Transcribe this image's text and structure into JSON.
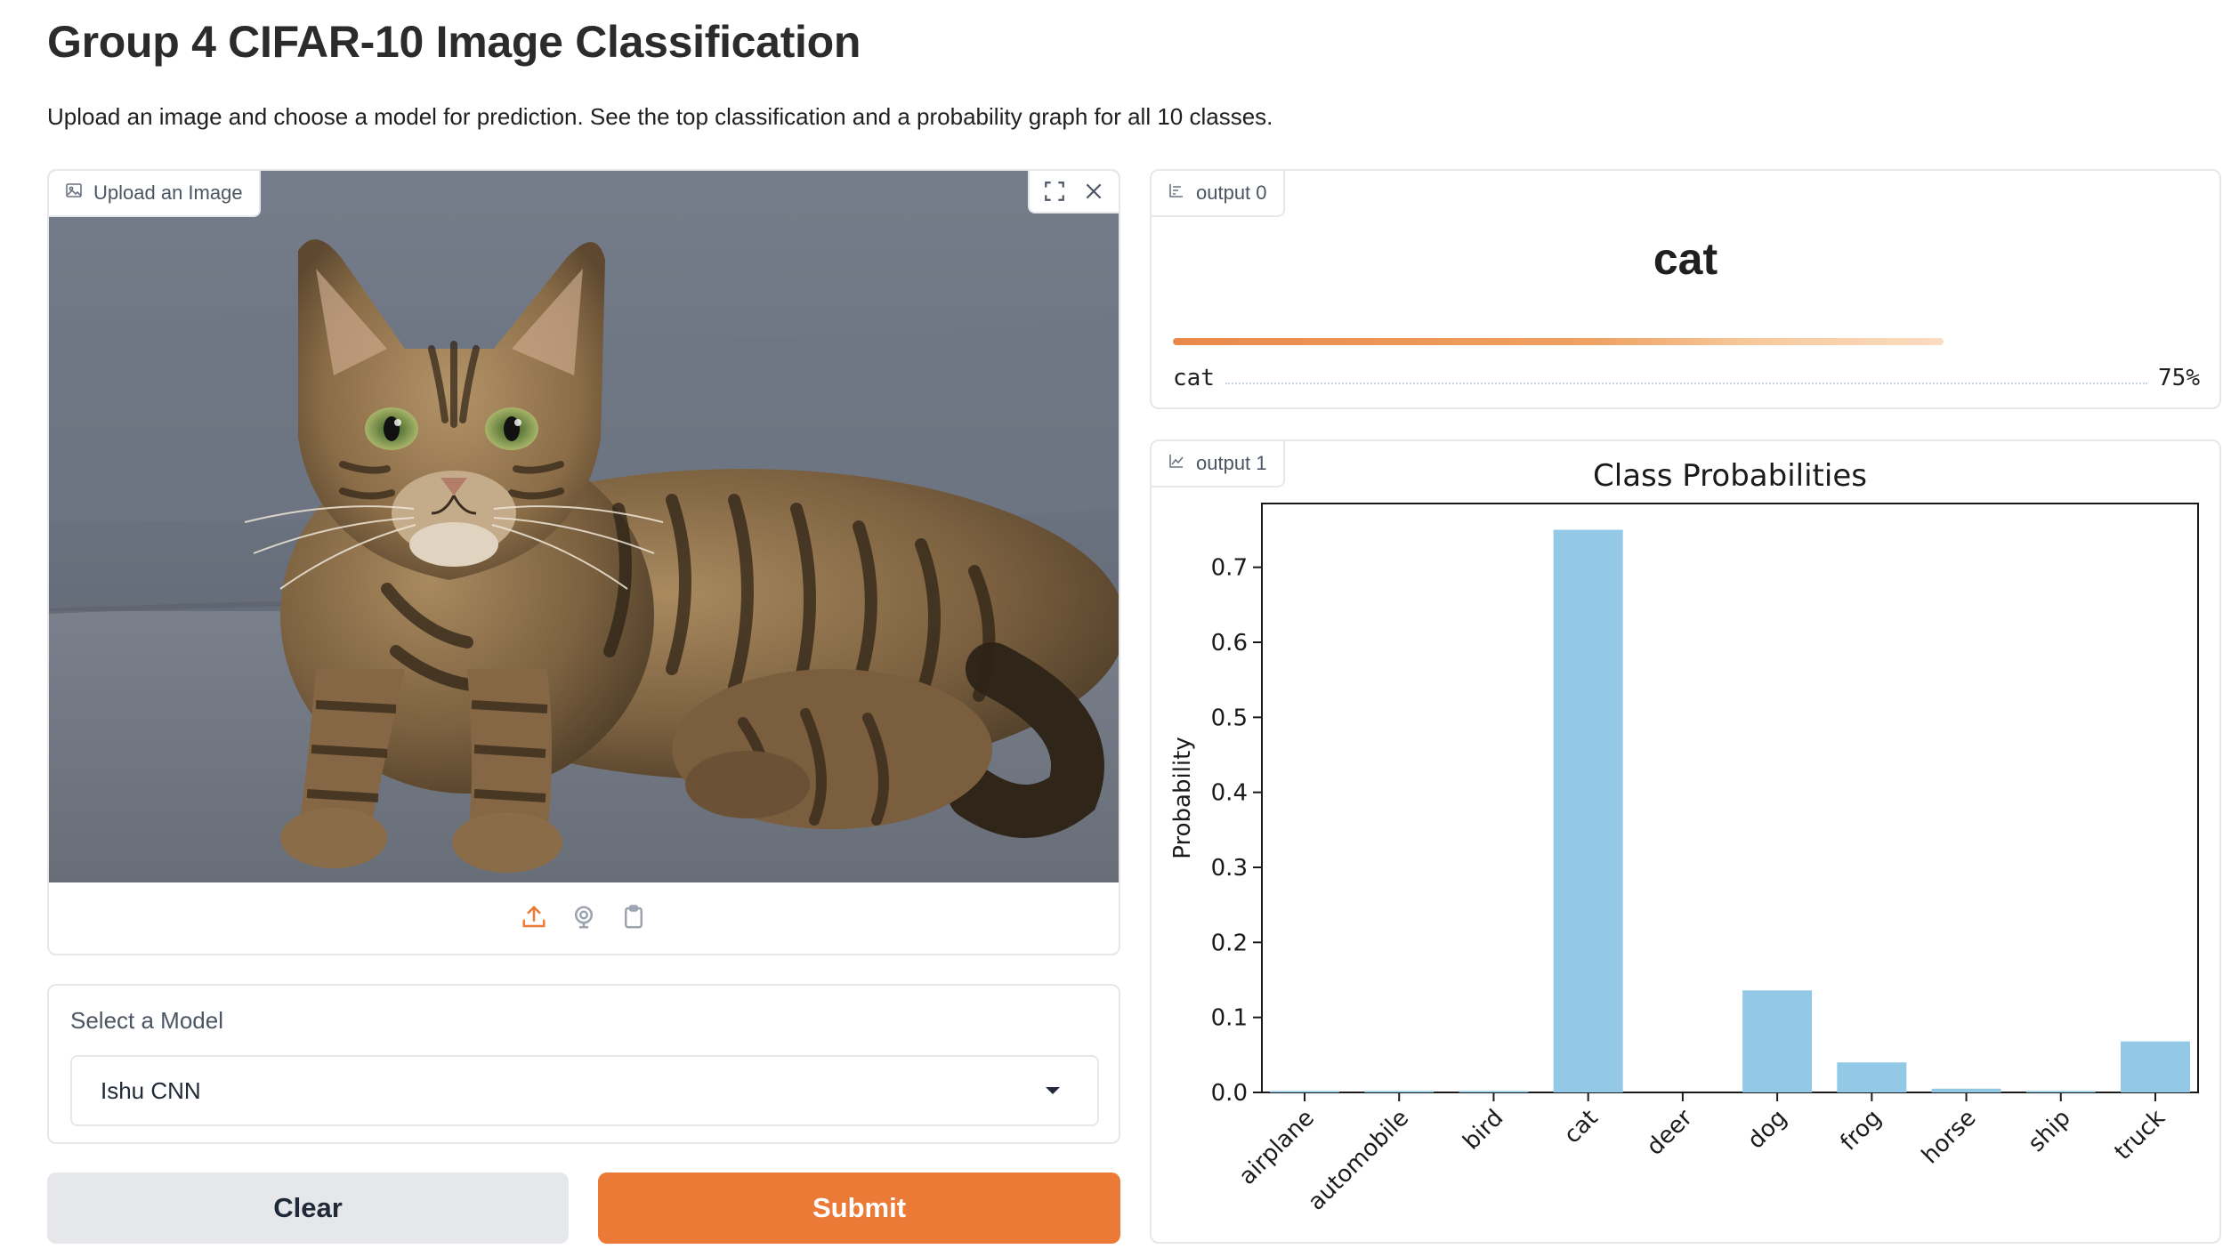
{
  "header": {
    "title": "Group 4 CIFAR-10 Image Classification",
    "description": "Upload an image and choose a model for prediction. See the top classification and a probability graph for all 10 classes."
  },
  "upload": {
    "label": "Upload an Image",
    "image_subject": "tabby cat lying on a gray sofa",
    "tools": [
      "fullscreen-icon",
      "close-icon"
    ],
    "sources": [
      "upload-icon",
      "webcam-icon",
      "clipboard-icon"
    ]
  },
  "model": {
    "label": "Select a Model",
    "selected": "Ishu CNN"
  },
  "buttons": {
    "clear": "Clear",
    "submit": "Submit"
  },
  "output0": {
    "tag": "output 0",
    "top_label": "cat",
    "confidences": [
      {
        "label": "cat",
        "value": "75%",
        "fraction": 0.75
      }
    ]
  },
  "output1": {
    "tag": "output 1"
  },
  "colors": {
    "accent": "#ea7a35",
    "bar": "#93c9e6",
    "clear_bg": "#e5e7eb"
  },
  "chart_data": {
    "type": "bar",
    "title": "Class Probabilities",
    "xlabel": "",
    "ylabel": "Probability",
    "categories": [
      "airplane",
      "automobile",
      "bird",
      "cat",
      "deer",
      "dog",
      "frog",
      "horse",
      "ship",
      "truck"
    ],
    "values": [
      0.002,
      0.002,
      0.002,
      0.75,
      0.0,
      0.136,
      0.04,
      0.005,
      0.002,
      0.068
    ],
    "ylim": [
      0.0,
      0.785
    ],
    "yticks": [
      "0.0",
      "0.1",
      "0.2",
      "0.3",
      "0.4",
      "0.5",
      "0.6",
      "0.7"
    ],
    "grid": false,
    "legend": "none"
  }
}
